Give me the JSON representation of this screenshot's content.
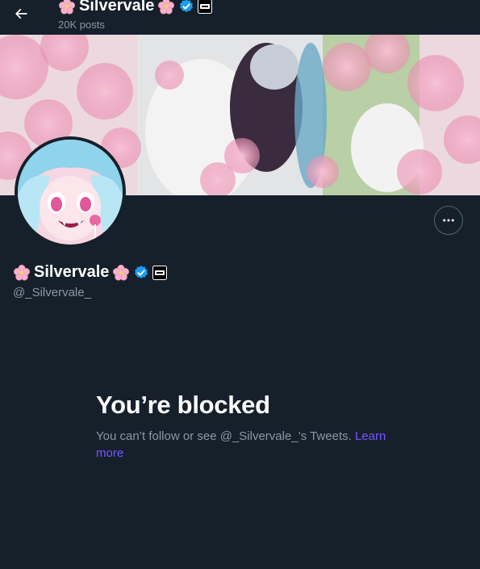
{
  "header": {
    "title_name": "Silvervale",
    "post_count": "20K posts",
    "back_icon": "arrow-left-icon"
  },
  "profile": {
    "name": "Silvervale",
    "handle": "@_Silvervale_",
    "more_icon": "more-horizontal-icon"
  },
  "blocked": {
    "heading": "You’re blocked",
    "message": "You can’t follow or see @_Silvervale_’s Tweets.",
    "learn_more": "Learn more"
  },
  "colors": {
    "background": "#15202b",
    "secondary_text": "#8b98a5",
    "verified_blue": "#1d9bf0",
    "link": "#7856ff",
    "blossom_pink": "#f4a7c1"
  }
}
